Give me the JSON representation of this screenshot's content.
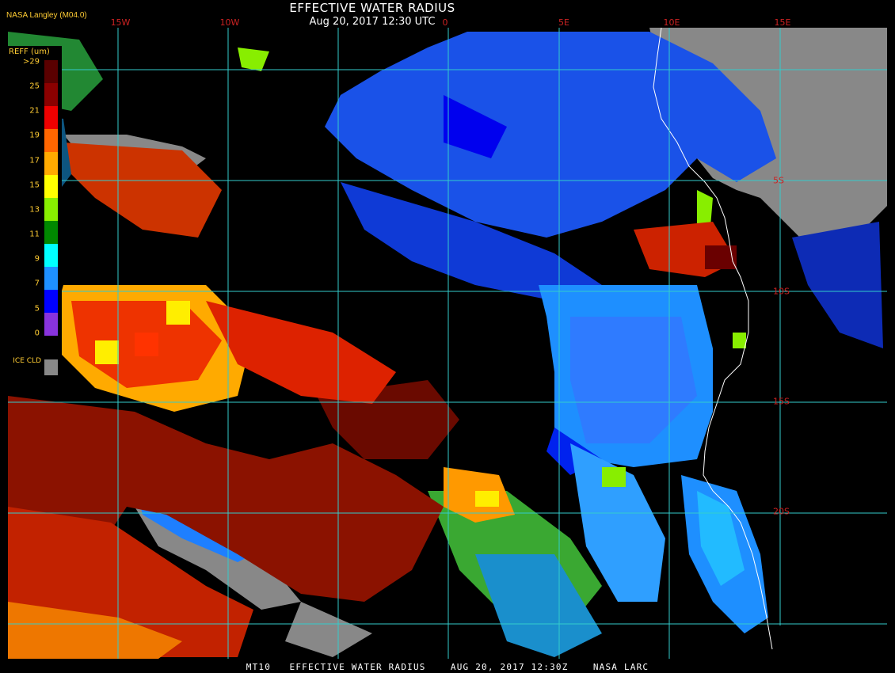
{
  "title": "EFFECTIVE WATER RADIUS",
  "timestamp": "Aug 20, 2017 12:30 UTC",
  "credit": "NASA Langley (M04.0)",
  "footer": "MT10   EFFECTIVE WATER RADIUS    AUG 20, 2017 12:30Z    NASA LARC",
  "longitude_labels": [
    "15W",
    "10W",
    "0",
    "5E",
    "10E",
    "15E"
  ],
  "latitude_labels": [
    "5S",
    "10S",
    "15S",
    "20S"
  ],
  "legend": {
    "title": "REFF (um)",
    "labels": [
      ">29",
      "25",
      "21",
      "19",
      "17",
      "15",
      "13",
      "11",
      "9",
      "7",
      "5",
      "0"
    ],
    "colors": [
      "#5a0000",
      "#8b0000",
      "#ee0000",
      "#ff6600",
      "#ffaa00",
      "#ffff00",
      "#88ee00",
      "#008800",
      "#00ffff",
      "#1e90ff",
      "#0000ff",
      "#8833dd"
    ],
    "ice_label": "ICE CLD",
    "ice_color": "#888888"
  },
  "colors": {
    "grid": "#33cccc",
    "coastline": "#ffffff",
    "land": "#888888"
  }
}
